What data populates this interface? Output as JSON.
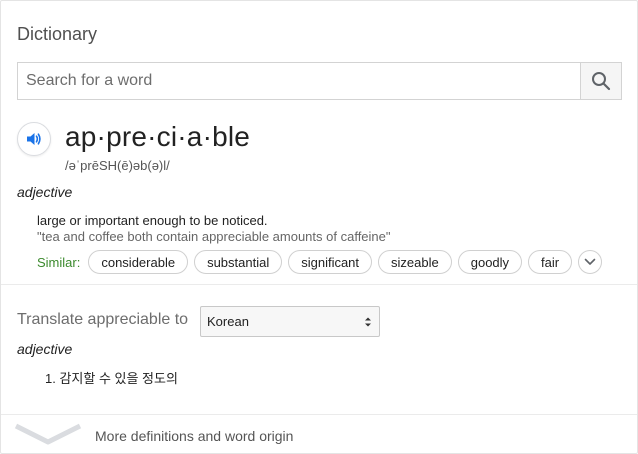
{
  "card": {
    "title": "Dictionary"
  },
  "search": {
    "placeholder": "Search for a word",
    "value": ""
  },
  "entry": {
    "headword": "ap·pre·ci·a·ble",
    "phonetic": "/əˈprēSH(ē)əb(ə)l/",
    "part_of_speech": "adjective",
    "definition": "large or important enough to be noticed.",
    "example": "\"tea and coffee both contain appreciable amounts of caffeine\"",
    "similar_label": "Similar:",
    "similar": [
      "considerable",
      "substantial",
      "significant",
      "sizeable",
      "goodly",
      "fair"
    ]
  },
  "translate": {
    "label": "Translate appreciable to",
    "language": "Korean",
    "part_of_speech": "adjective",
    "items": [
      "1. 감지할 수 있을 정도의"
    ]
  },
  "footer": {
    "more_link": "More definitions and word origin"
  },
  "icons": {
    "search": "search-icon",
    "speaker": "speaker-icon",
    "expand": "chevron-down-icon",
    "footer_expand": "chevron-down-icon",
    "select_arrows": "select-arrows-icon"
  },
  "colors": {
    "accent_blue": "#1a73e8",
    "similar_green": "#3c8a2e"
  }
}
